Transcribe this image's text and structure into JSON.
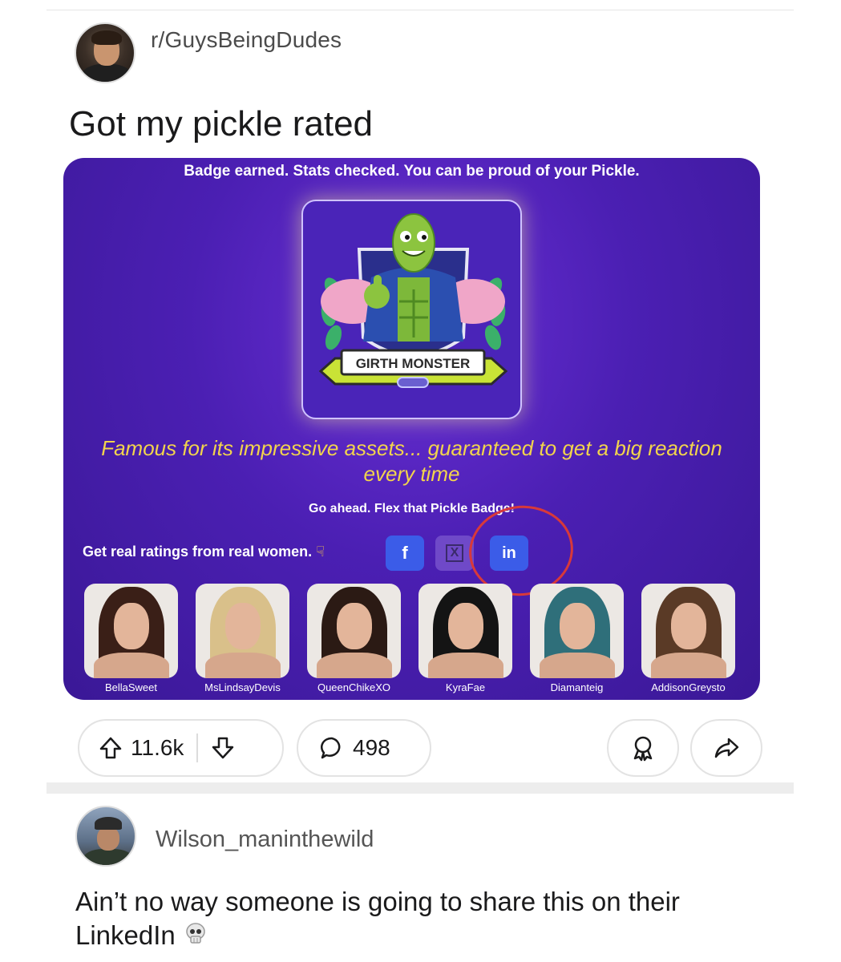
{
  "post": {
    "subreddit": "r/GuysBeingDudes",
    "title": "Got my pickle rated"
  },
  "embedded_image": {
    "top_text": "Badge earned. Stats checked. You can be proud of your Pickle.",
    "badge_banner": "GIRTH MONSTER",
    "tagline": "Famous for its impressive assets... guaranteed to get a big reaction every time",
    "flex_text": "Go ahead. Flex that Pickle Badge!",
    "ratings_text": "Get real ratings from real women.",
    "share_buttons": {
      "facebook": "f",
      "x": "X",
      "linkedin": "in"
    },
    "raters": [
      {
        "name": "BellaSweet",
        "hair": "#3a1f17"
      },
      {
        "name": "MsLindsayDevis",
        "hair": "#d9c08a"
      },
      {
        "name": "QueenChikeXO",
        "hair": "#2b1a14"
      },
      {
        "name": "KyraFae",
        "hair": "#141414"
      },
      {
        "name": "Diamanteig",
        "hair": "#2f6f7a"
      },
      {
        "name": "AddisonGreysto",
        "hair": "#5a3a26"
      }
    ]
  },
  "actions": {
    "upvotes": "11.6k",
    "comments": "498"
  },
  "comment": {
    "username": "Wilson_maninthewild",
    "text": "Ain’t no way someone is going to share this on their LinkedIn"
  },
  "colors": {
    "card_purple": "#4b1fb3",
    "tagline_yellow": "#f2d44c",
    "highlight_red": "#d8393a",
    "linkedin_blue": "#3b5ce8"
  }
}
